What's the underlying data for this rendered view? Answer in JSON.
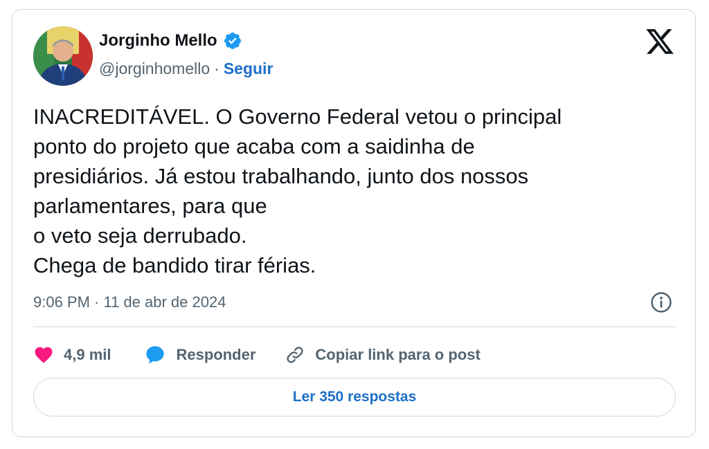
{
  "author": {
    "name": "Jorginho Mello",
    "handle": "@jorginhomello",
    "separator": "·",
    "follow_label": "Seguir"
  },
  "tweet": {
    "lines": [
      "INACREDITÁVEL. O Governo Federal vetou o principal",
      "ponto do projeto que acaba com a saidinha de",
      "presidiários. Já estou trabalhando, junto dos nossos",
      "parlamentares, para que",
      "o veto seja derrubado.",
      "Chega de bandido tirar férias."
    ],
    "timestamp": "9:06 PM · 11 de abr de 2024"
  },
  "actions": {
    "likes_label": "4,9 mil",
    "reply_label": "Responder",
    "copy_link_label": "Copiar link para o post"
  },
  "read_replies_label": "Ler 350 respostas",
  "icons": {
    "platform": "x-logo-icon",
    "verified": "verified-badge-icon",
    "info": "info-icon",
    "like": "heart-icon",
    "reply": "speech-bubble-icon",
    "copy": "link-icon"
  },
  "colors": {
    "link_blue": "#1d6fc7",
    "verified_blue": "#1d9bf0",
    "heart_pink": "#f91880",
    "text_primary": "#0f1419",
    "text_secondary": "#536471",
    "border": "#cfd9de"
  }
}
